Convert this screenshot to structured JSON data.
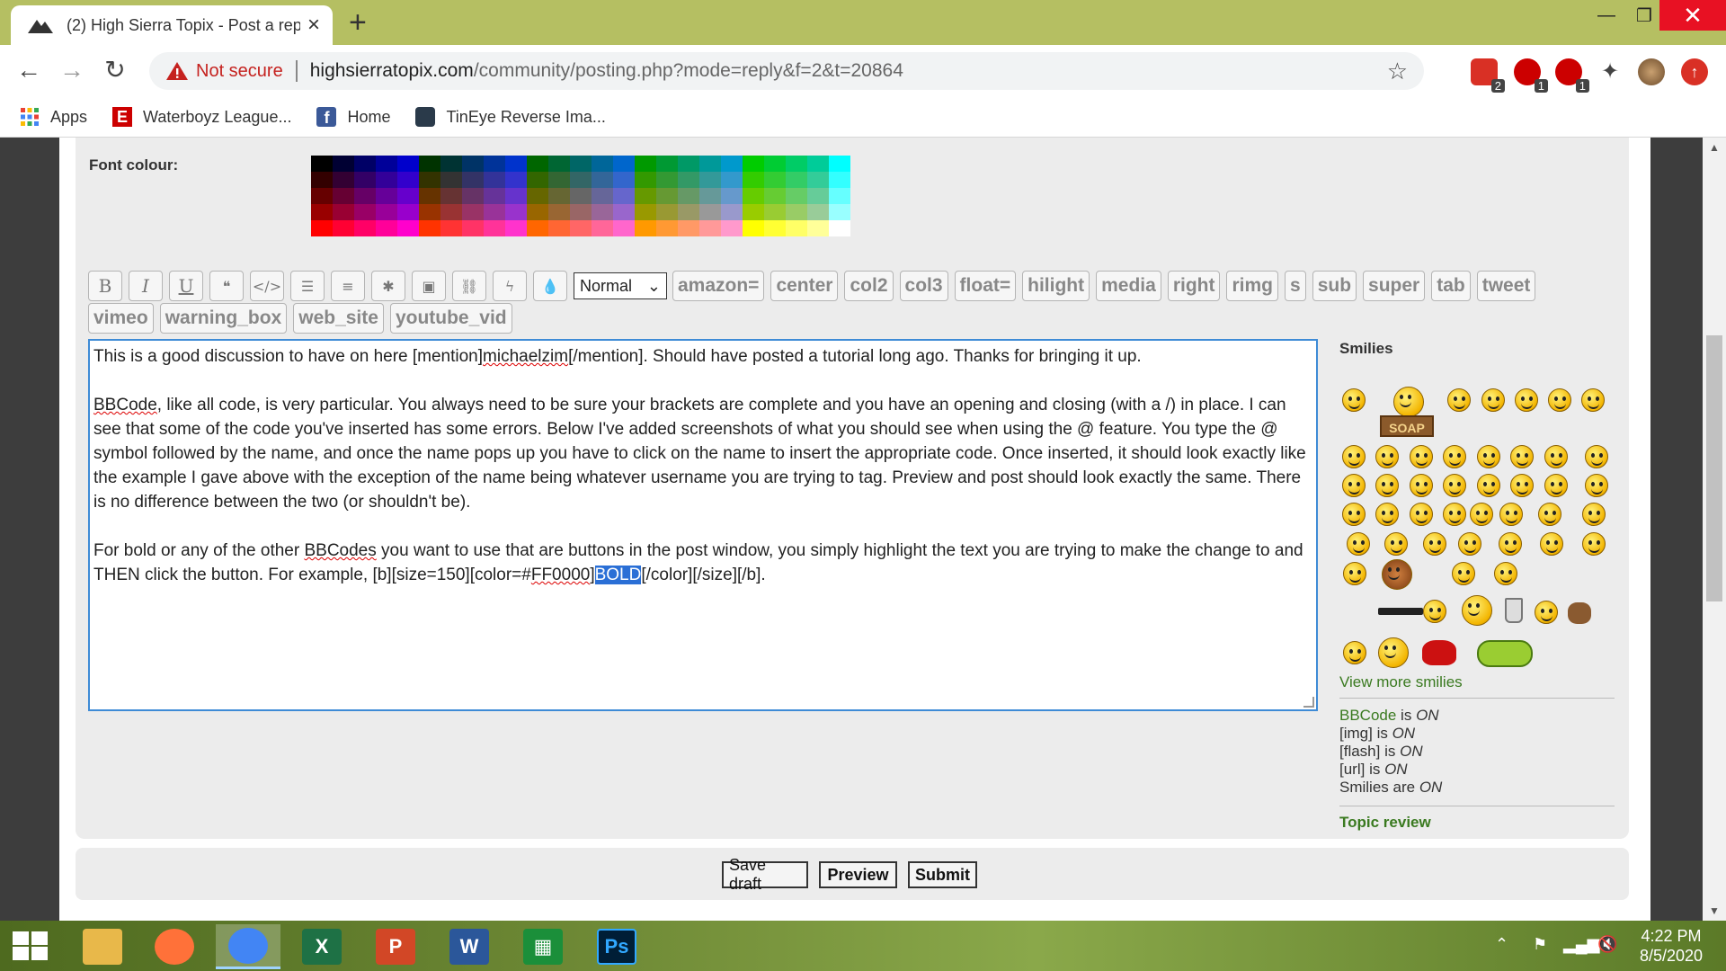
{
  "browser": {
    "tab_title": "(2) High Sierra Topix - Post a repl",
    "not_secure": "Not secure",
    "url_host": "highsierratopix.com",
    "url_path": "/community/posting.php?mode=reply&f=2&t=20864",
    "extension_badges": [
      "2",
      "1",
      "1"
    ],
    "bookmarks": [
      "Apps",
      "Waterboyz League...",
      "Home",
      "TinEye Reverse Ima..."
    ]
  },
  "colors": {
    "accent": "#b5bf62",
    "link": "#3a7a20",
    "editor_border": "#3e8bd6",
    "panel_bg": "#ececec"
  },
  "page": {
    "font_colour_label": "Font colour:",
    "palette_colors": [
      "#000000",
      "#000033",
      "#000066",
      "#000099",
      "#0000cc",
      "#003300",
      "#003333",
      "#003366",
      "#003399",
      "#0033cc",
      "#006600",
      "#006633",
      "#006666",
      "#006699",
      "#0066cc",
      "#009900",
      "#009933",
      "#009966",
      "#009999",
      "#0099cc",
      "#00cc00",
      "#00cc33",
      "#00cc66",
      "#00cc99",
      "#00ffff",
      "#330000",
      "#330033",
      "#330066",
      "#330099",
      "#3300cc",
      "#333300",
      "#333333",
      "#333366",
      "#333399",
      "#3333cc",
      "#336600",
      "#336633",
      "#336666",
      "#336699",
      "#3366cc",
      "#339900",
      "#339933",
      "#339966",
      "#339999",
      "#3399cc",
      "#33cc00",
      "#33cc33",
      "#33cc66",
      "#33cc99",
      "#33ffff",
      "#660000",
      "#660033",
      "#660066",
      "#660099",
      "#6600cc",
      "#663300",
      "#663333",
      "#663366",
      "#663399",
      "#6633cc",
      "#666600",
      "#666633",
      "#666666",
      "#666699",
      "#6666cc",
      "#669900",
      "#669933",
      "#669966",
      "#669999",
      "#6699cc",
      "#66cc00",
      "#66cc33",
      "#66cc66",
      "#66cc99",
      "#66ffff",
      "#990000",
      "#990033",
      "#990066",
      "#990099",
      "#9900cc",
      "#993300",
      "#993333",
      "#993366",
      "#993399",
      "#9933cc",
      "#996600",
      "#996633",
      "#996666",
      "#996699",
      "#9966cc",
      "#999900",
      "#999933",
      "#999966",
      "#999999",
      "#9999cc",
      "#99cc00",
      "#99cc33",
      "#99cc66",
      "#99cc99",
      "#99ffff",
      "#ff0000",
      "#ff0033",
      "#ff0066",
      "#ff0099",
      "#ff00cc",
      "#ff3300",
      "#ff3333",
      "#ff3366",
      "#ff3399",
      "#ff33cc",
      "#ff6600",
      "#ff6633",
      "#ff6666",
      "#ff6699",
      "#ff66cc",
      "#ff9900",
      "#ff9933",
      "#ff9966",
      "#ff9999",
      "#ff99cc",
      "#ffff00",
      "#ffff33",
      "#ffff66",
      "#ffff99",
      "#ffffff"
    ],
    "toolbar_icons": [
      "B",
      "I",
      "U",
      "quote-icon",
      "code-icon",
      "list-icon",
      "numbered-list-icon",
      "list-item-icon",
      "image-icon",
      "link-icon",
      "flash-icon",
      "color-drop-icon"
    ],
    "toolbar_icon_glyphs": [
      "B",
      "I",
      "U",
      "❝",
      "</>",
      "☰",
      "≡",
      "✱",
      "▣",
      "⛓",
      "ϟ",
      "💧"
    ],
    "size_select": "Normal",
    "bbcode_buttons_row1": [
      "amazon=",
      "center",
      "col2",
      "col3",
      "float=",
      "hilight",
      "media",
      "right",
      "rimg",
      "s",
      "sub",
      "super",
      "tab",
      "tweet"
    ],
    "bbcode_buttons_row2": [
      "vimeo",
      "warning_box",
      "web_site",
      "youtube_vid"
    ],
    "editor": {
      "p1a": "This is a good discussion to have on here [mention]",
      "p1b": "michaelzim",
      "p1c": "[/mention]. Should have posted a tutorial long ago. Thanks for bringing it up.",
      "p2a": "BBCode",
      "p2b": ", like all code, is very particular. You always need to be sure your brackets are complete and you have an opening and closing (with a /) in place. I can see that some of the code you've inserted has some errors. Below I've added screenshots of what you should see when using the @ feature. You type the @ symbol followed by the name, and once the name pops up you have to click on the name to insert the appropriate code. Once inserted, it should look exactly like the example I gave above with the exception of the name being whatever username you are trying to tag. Preview and post should look exactly the same. There is no difference between the two (or shouldn't be).",
      "p3a": "For bold or any of the other ",
      "p3b": "BBCodes",
      "p3c": " you want to use that are buttons in the post window, you simply highlight the text you are trying to make the change to and THEN click the button. For example, [b][size=150][color=#",
      "p3d": "FF0000",
      "p3e": "]",
      "p3f": "BOLD",
      "p3g": "[/color][/size][/b]."
    },
    "smilies_heading": "Smilies",
    "soap_sign": "SOAP",
    "view_more_smilies": "View more smilies",
    "status": {
      "bbcode_label": "BBCode",
      "is": " is ",
      "on": "ON",
      "img_label": "[img]",
      "flash_label": "[flash]",
      "url_label": "[url]",
      "smilies_label": "Smilies are "
    },
    "topic_review": "Topic review",
    "buttons": {
      "save_draft": "Save draft",
      "preview": "Preview",
      "submit": "Submit"
    }
  },
  "taskbar": {
    "apps": [
      "file-explorer",
      "firefox",
      "chrome",
      "excel",
      "powerpoint",
      "word",
      "spreadsheet",
      "photoshop"
    ],
    "app_glyphs": [
      "",
      "",
      "",
      "X",
      "P",
      "W",
      "▦",
      "Ps"
    ],
    "time": "4:22 PM",
    "date": "8/5/2020"
  }
}
